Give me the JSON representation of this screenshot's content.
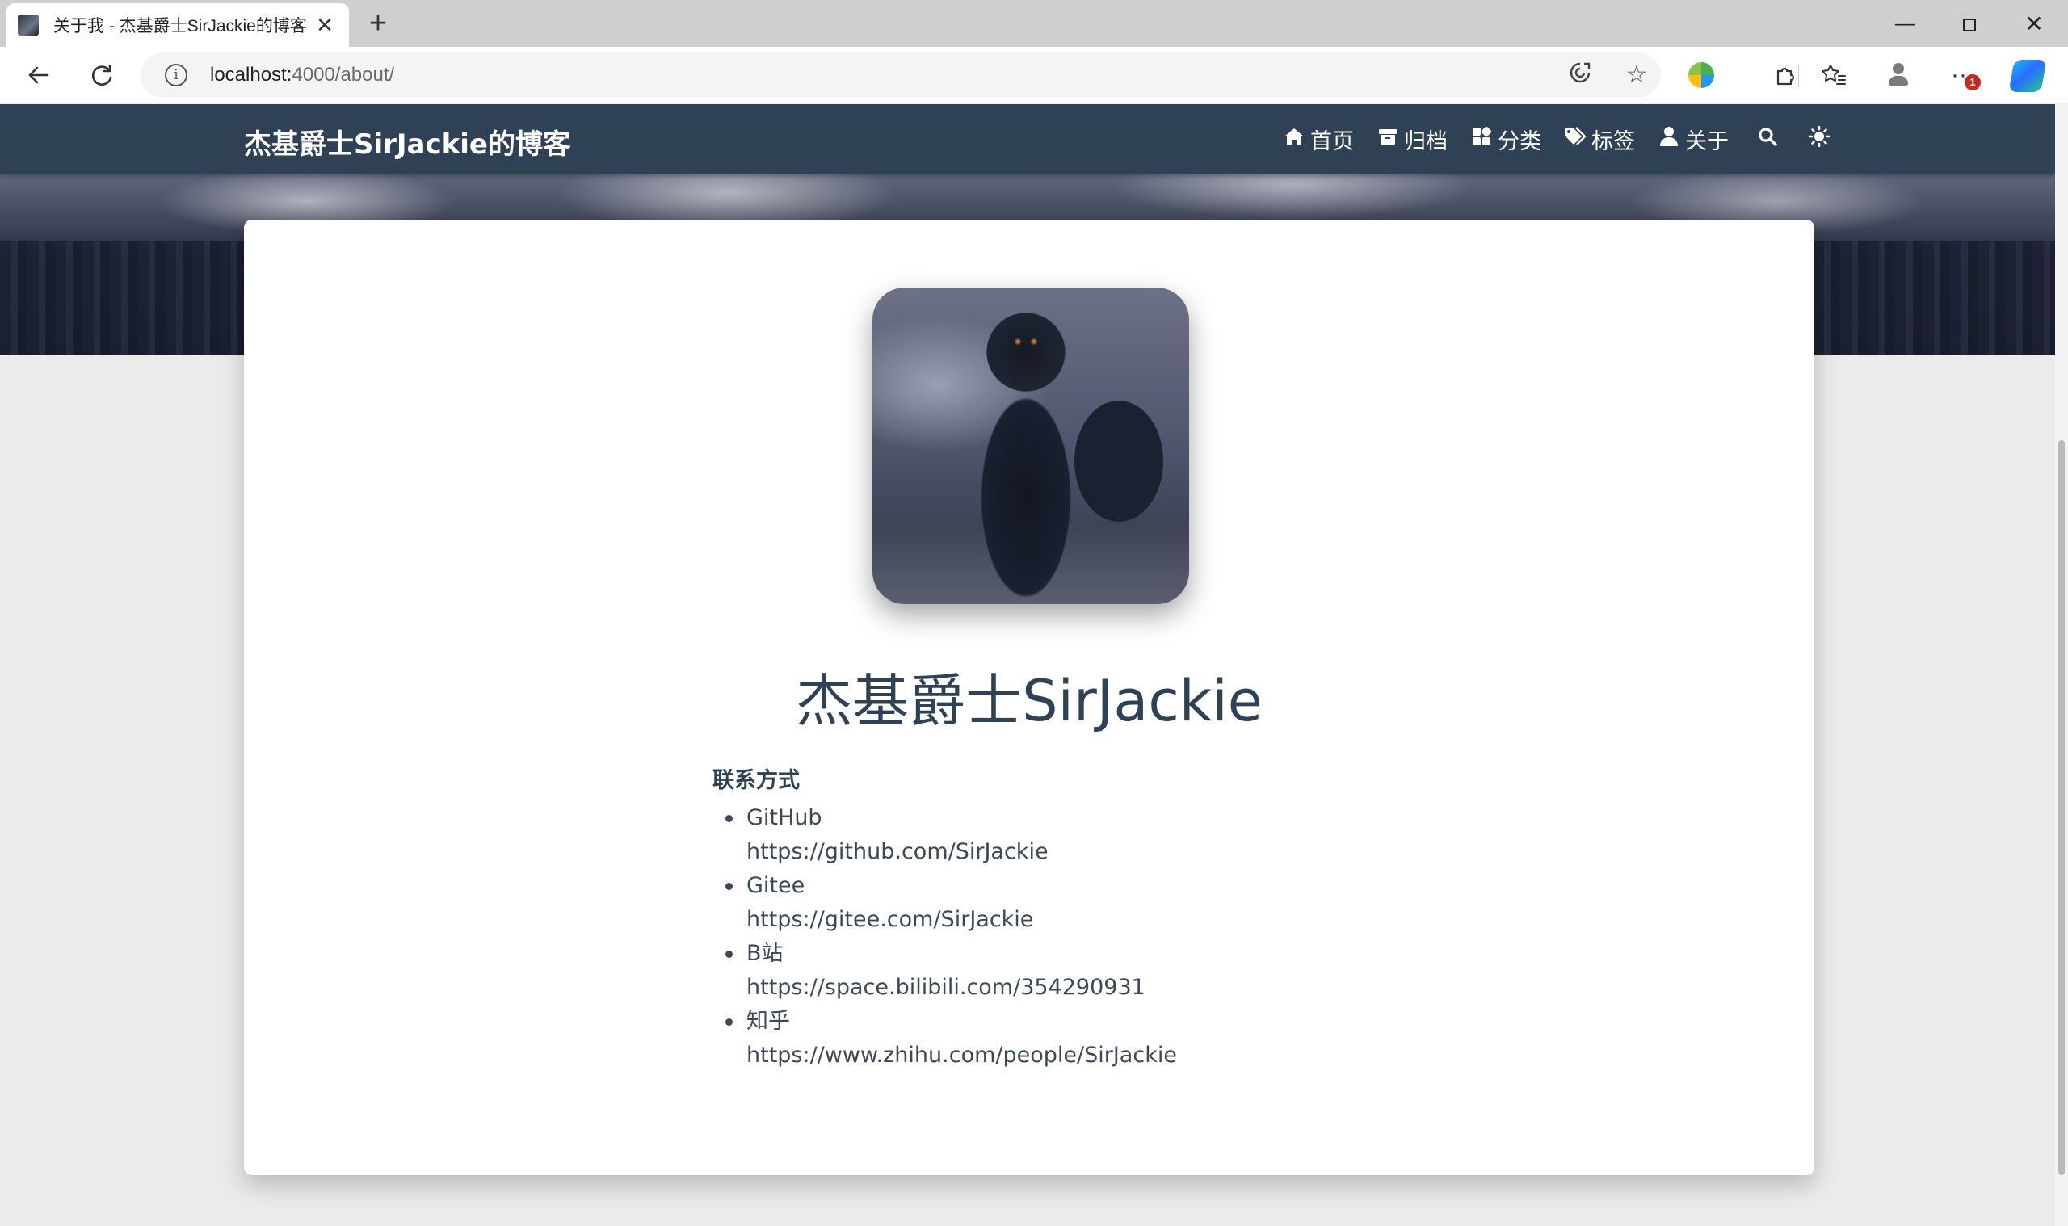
{
  "browser": {
    "tab_title": "关于我 - 杰基爵士SirJackie的博客",
    "tab_close": "✕",
    "new_tab": "+",
    "url_host": "localhost:",
    "url_path": "4000/about/",
    "more_badge": "1"
  },
  "navbar": {
    "brand": "杰基爵士SirJackie的博客",
    "items": [
      {
        "icon": "home-icon",
        "label": "首页"
      },
      {
        "icon": "archive-icon",
        "label": "归档"
      },
      {
        "icon": "category-icon",
        "label": "分类"
      },
      {
        "icon": "tag-icon",
        "label": "标签"
      },
      {
        "icon": "user-icon",
        "label": "关于"
      }
    ]
  },
  "about": {
    "author_name": "杰基爵士SirJackie",
    "section_title": "联系方式",
    "contacts": [
      {
        "name": "GitHub",
        "url": "https://github.com/SirJackie"
      },
      {
        "name": "Gitee",
        "url": "https://gitee.com/SirJackie"
      },
      {
        "name": "B站",
        "url": "https://space.bilibili.com/354290931"
      },
      {
        "name": "知乎",
        "url": "https://www.zhihu.com/people/SirJackie"
      }
    ]
  },
  "colors": {
    "navbar_bg": "#2f4154",
    "text": "#3c4858",
    "page_bg": "#ebebeb"
  }
}
